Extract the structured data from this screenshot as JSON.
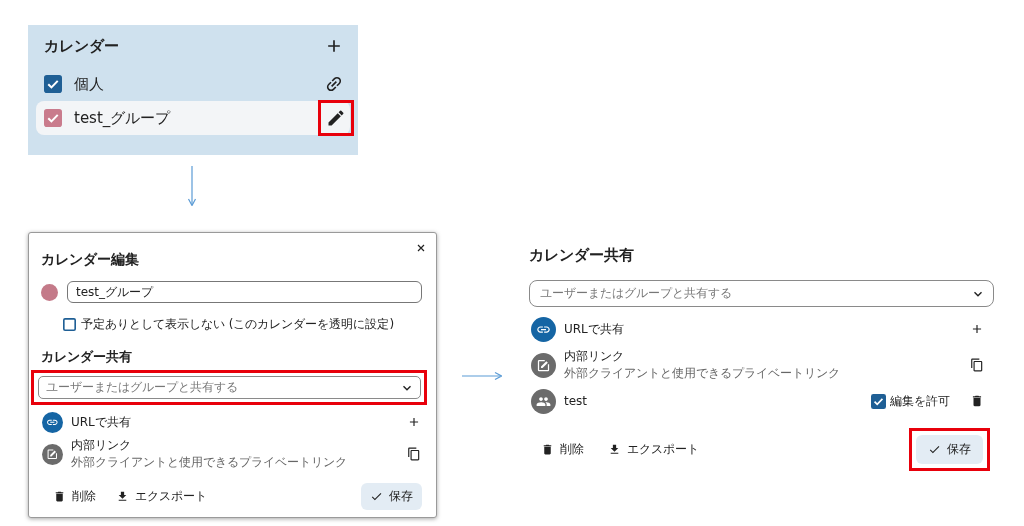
{
  "calendar_sidebar": {
    "title": "カレンダー",
    "items": [
      {
        "name": "個人",
        "checked": true,
        "color": "#1f5f95",
        "action": {
          "kind": "link"
        },
        "selected": false,
        "highlighted": false
      },
      {
        "name": "test_グループ",
        "checked": true,
        "color": "#c97b8c",
        "action": {
          "kind": "edit"
        },
        "selected": true,
        "highlighted": true
      }
    ]
  },
  "edit_dialog": {
    "title": "カレンダー編集",
    "color": "#c47a89",
    "name_value": "test_グループ",
    "transparent_option": {
      "label": "予定ありとして表示しない (このカレンダーを透明に設定)",
      "checked": false
    },
    "sharing": {
      "title": "カレンダー共有",
      "share_field": {
        "placeholder": "ユーザーまたはグループと共有する",
        "highlighted": true
      },
      "entries": [
        {
          "kind": "url",
          "title": "URLで共有",
          "color": "#1565a4",
          "action": {
            "kind": "add"
          }
        },
        {
          "kind": "internal",
          "title": "内部リンク",
          "subtitle": "外部クライアントと使用できるプライベートリンク",
          "color": "#6b6b6b",
          "action": {
            "kind": "copy"
          }
        }
      ]
    },
    "footer": {
      "delete": "削除",
      "export": "エクスポート",
      "save": {
        "label": "保存",
        "highlighted": false
      }
    }
  },
  "share_panel": {
    "title": "カレンダー共有",
    "share_field": {
      "placeholder": "ユーザーまたはグループと共有する",
      "highlighted": false
    },
    "entries": [
      {
        "kind": "url",
        "title": "URLで共有",
        "color": "#1565a4",
        "action": {
          "kind": "add"
        }
      },
      {
        "kind": "internal",
        "title": "内部リンク",
        "subtitle": "外部クライアントと使用できるプライベートリンク",
        "color": "#6b6b6b",
        "action": {
          "kind": "copy"
        }
      },
      {
        "kind": "user",
        "title": "test",
        "color": "#6b6b6b",
        "edit_permission": {
          "label": "編集を許可",
          "checked": true
        },
        "action": {
          "kind": "delete"
        }
      }
    ],
    "footer": {
      "delete": "削除",
      "export": "エクスポート",
      "save": {
        "label": "保存",
        "highlighted": true
      }
    }
  }
}
